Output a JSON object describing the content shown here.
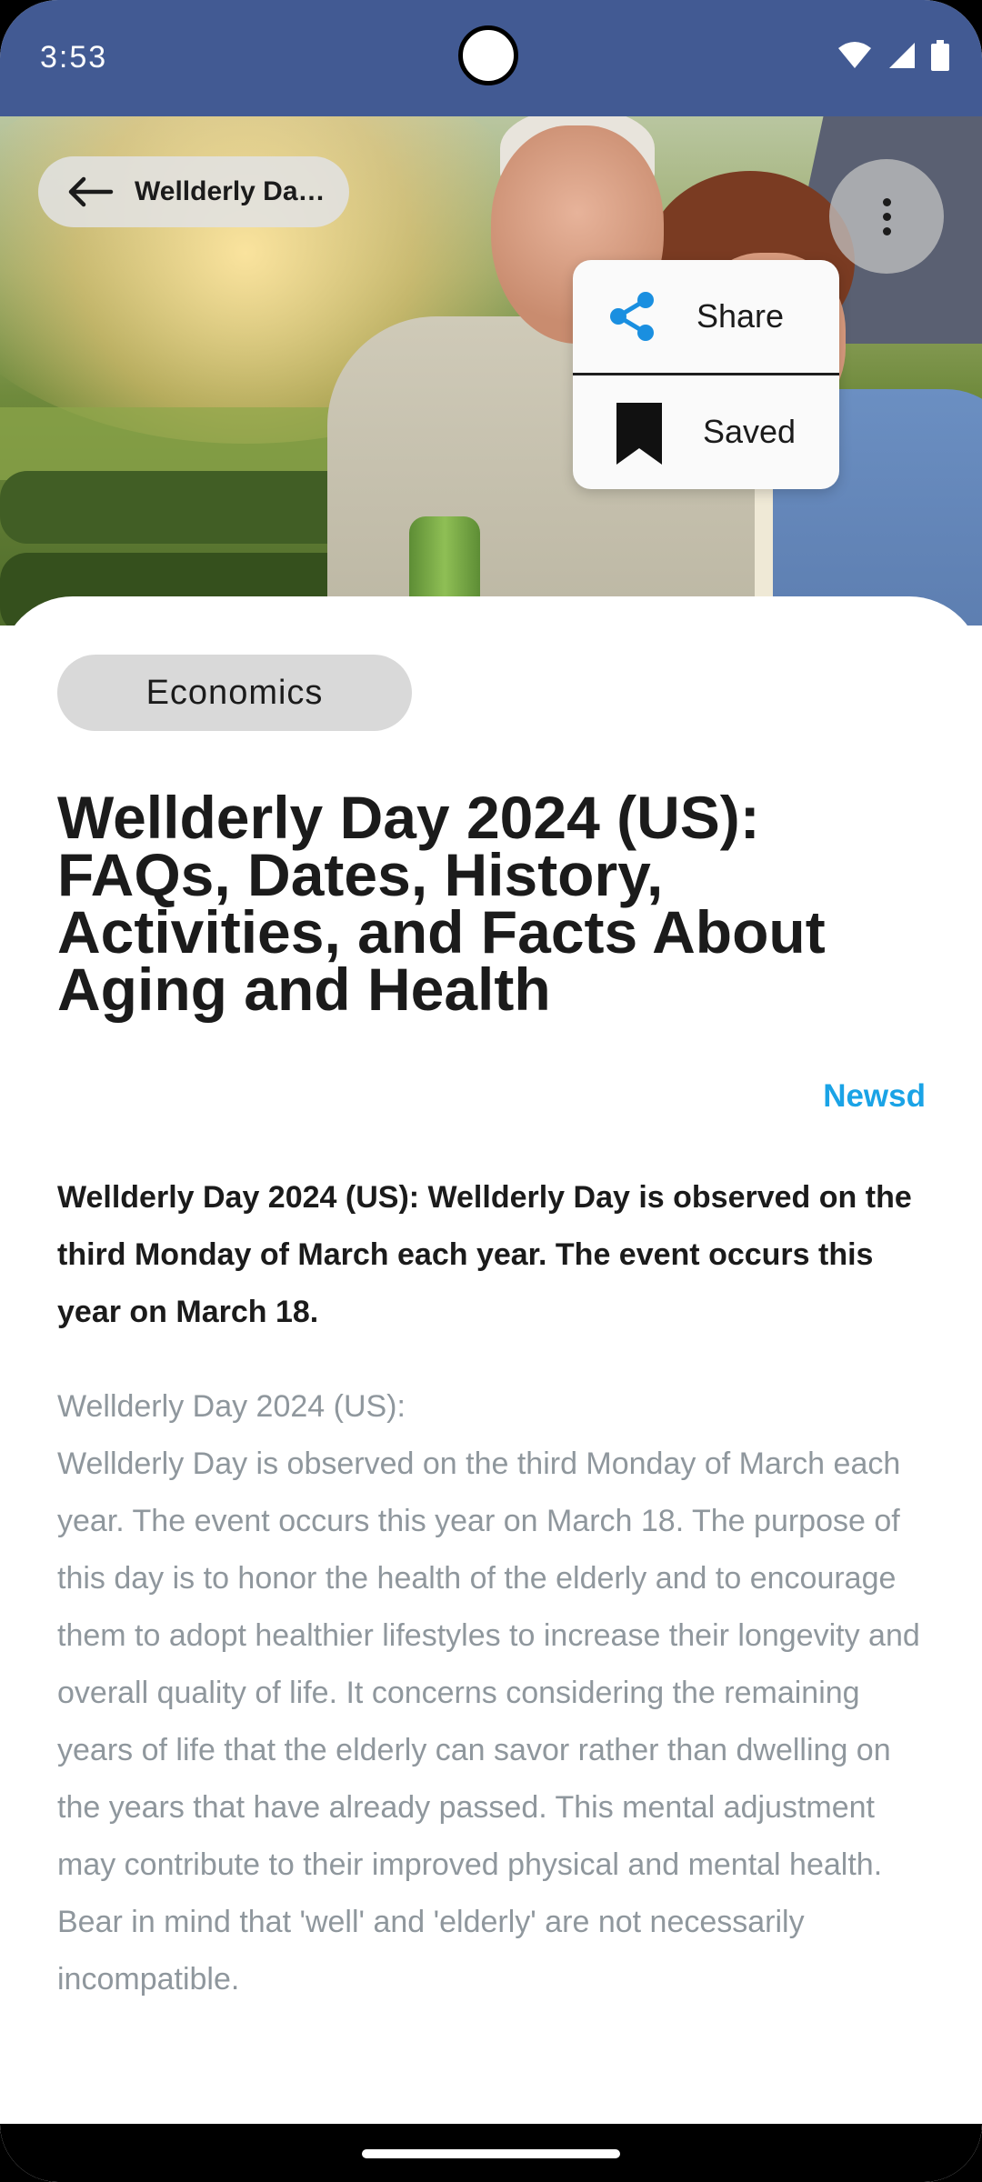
{
  "status_bar": {
    "time": "3:53"
  },
  "header": {
    "back_title": "Wellderly Da…",
    "menu": {
      "share_label": "Share",
      "saved_label": "Saved"
    }
  },
  "article": {
    "category": "Economics",
    "title": "Wellderly Day 2024 (US): FAQs, Dates, History, Activities, and Facts About Aging and Health",
    "source": "Newsd",
    "lead": "Wellderly Day 2024 (US): Wellderly Day is observed on the third Monday of March each year. The event occurs this year on March 18.",
    "body_heading": "Wellderly Day 2024 (US):",
    "body": "Wellderly Day is observed on the third Monday of March each year. The event occurs this year on March 18. The purpose of this day is to honor the health of the elderly and to encourage them to adopt healthier lifestyles to increase their longevity and overall quality of life. It concerns considering the remaining years of life that the elderly can savor rather than dwelling on the years that have already passed. This mental adjustment may contribute to their improved physical and mental health. Bear in mind that 'well' and 'elderly' are not necessarily incompatible."
  },
  "colors": {
    "status_bar": "#425a93",
    "accent_source": "#1aa3e6",
    "share_icon": "#1a8fe0"
  },
  "icons": [
    "back-arrow-icon",
    "more-vert-icon",
    "share-icon",
    "bookmark-icon",
    "wifi-icon",
    "signal-icon",
    "battery-icon"
  ]
}
